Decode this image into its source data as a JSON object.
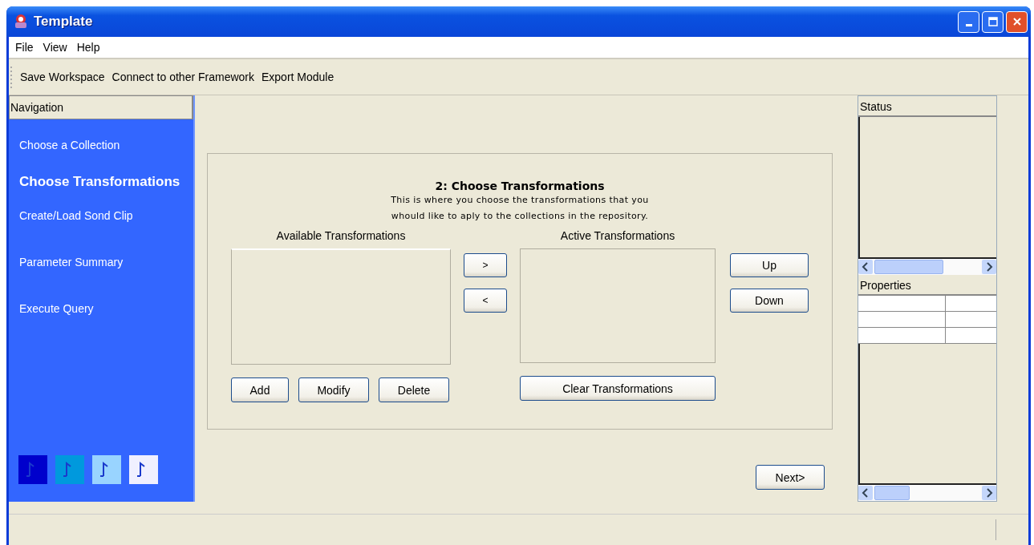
{
  "window": {
    "title": "Template"
  },
  "menu": [
    "File",
    "View",
    "Help"
  ],
  "toolbar": [
    "Save Workspace",
    "Connect to other Framework",
    "Export Module"
  ],
  "navigation": {
    "title": "Navigation",
    "items": [
      {
        "label": "Choose a Collection",
        "selected": false
      },
      {
        "label": "Choose Transformations",
        "selected": true
      },
      {
        "label": "Create/Load Sond Clip",
        "selected": false
      },
      {
        "label": "Parameter Summary",
        "selected": false
      },
      {
        "label": "Execute Query",
        "selected": false
      }
    ],
    "tiles": [
      {
        "color": "#0000cc"
      },
      {
        "color": "#0099dd"
      },
      {
        "color": "#99d4ff"
      },
      {
        "color": "#f0f0ff"
      }
    ]
  },
  "step": {
    "title": "2: Choose Transformations",
    "description": [
      "This is where you choose the transformations that you",
      "whould like to aply to the collections in the repository."
    ],
    "available_label": "Available Transformations",
    "active_label": "Active Transformations",
    "add_button": "> ",
    "remove_button": "<",
    "up_button": "Up",
    "down_button": "Down",
    "list_buttons": [
      "Add",
      "Modify",
      "Delete"
    ],
    "clear_button": "Clear Transformations"
  },
  "next_button": "Next>",
  "status_panel": {
    "title": "Status"
  },
  "properties_panel": {
    "title": "Properties"
  }
}
